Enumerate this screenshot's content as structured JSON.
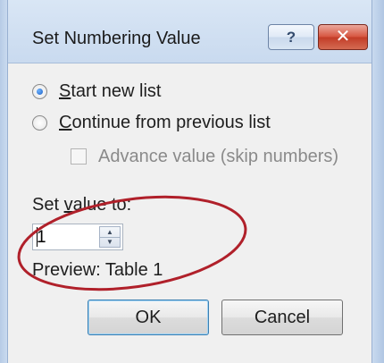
{
  "window": {
    "title": "Set Numbering Value",
    "help_glyph": "?",
    "close_glyph": "✕"
  },
  "options": {
    "start_new_list": {
      "u": "S",
      "rest": "tart new list",
      "selected": true
    },
    "continue_list": {
      "u": "C",
      "rest": "ontinue from previous list",
      "selected": false
    },
    "advance_value": {
      "label": "Advance value (skip numbers)",
      "checked": false,
      "enabled": false
    }
  },
  "set_value": {
    "label_before": "Set ",
    "label_u": "v",
    "label_after": "alue to:",
    "value": "1"
  },
  "preview": "Preview: Table 1",
  "buttons": {
    "ok": "OK",
    "cancel": "Cancel"
  },
  "annotation": {
    "color": "#b0202a",
    "shape": "ellipse"
  }
}
